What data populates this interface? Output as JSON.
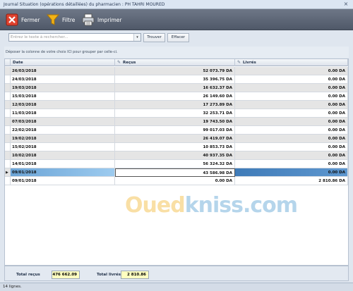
{
  "window": {
    "title": "Journal Situation (opérations détaillées) du pharmacien : PH TAHRI MOURED",
    "close_glyph": "×"
  },
  "toolbar": {
    "buttons": [
      {
        "label": "Fermer",
        "icon": "close-red-icon"
      },
      {
        "label": "Filtre",
        "icon": "funnel-icon"
      },
      {
        "label": "Imprimer",
        "icon": "printer-icon"
      }
    ]
  },
  "search": {
    "placeholder": "Entrez le texte à rechercher...",
    "find_label": "Trouver",
    "clear_label": "Effacer"
  },
  "group_panel": {
    "text": "Déposer la colonne de votre choix ICI pour grouper par celle-ci."
  },
  "grid": {
    "columns": [
      "Date",
      "Reçus",
      "Livrés"
    ],
    "rows": [
      {
        "date": "26/03/2018",
        "recus": "52 073.79 DA",
        "livres": "0.00 DA"
      },
      {
        "date": "24/03/2018",
        "recus": "35 396.75 DA",
        "livres": "0.00 DA"
      },
      {
        "date": "19/03/2018",
        "recus": "16 632.37 DA",
        "livres": "0.00 DA"
      },
      {
        "date": "15/03/2018",
        "recus": "26 149.60 DA",
        "livres": "0.00 DA"
      },
      {
        "date": "12/03/2018",
        "recus": "17 273.89 DA",
        "livres": "0.00 DA"
      },
      {
        "date": "11/03/2018",
        "recus": "32 253.71 DA",
        "livres": "0.00 DA"
      },
      {
        "date": "07/03/2018",
        "recus": "19 743.50 DA",
        "livres": "0.00 DA"
      },
      {
        "date": "22/02/2018",
        "recus": "99 017.03 DA",
        "livres": "0.00 DA"
      },
      {
        "date": "19/02/2018",
        "recus": "26 419.07 DA",
        "livres": "0.00 DA"
      },
      {
        "date": "15/02/2018",
        "recus": "10 853.73 DA",
        "livres": "0.00 DA"
      },
      {
        "date": "10/02/2018",
        "recus": "40 937.35 DA",
        "livres": "0.00 DA"
      },
      {
        "date": "14/01/2018",
        "recus": "56 324.32 DA",
        "livres": "0.00 DA"
      },
      {
        "date": "09/01/2018",
        "recus": "43 586.98 DA",
        "livres": "0.00 DA",
        "selected": true
      },
      {
        "date": "09/01/2018",
        "recus": "0.00 DA",
        "livres": "2 810.86 DA"
      }
    ]
  },
  "watermark": {
    "part1": "Oued",
    "part2": "kniss",
    "part3": ".com"
  },
  "footer": {
    "total_recus_label": "Total reçus",
    "total_recus_value": "476 662.09",
    "total_livres_label": "Total livrés",
    "total_livres_value": "2 810.86"
  },
  "status": {
    "text": "14 lignes."
  },
  "colors": {
    "toolbar": "#5a6373",
    "selection": "#5e97cf",
    "alt_row": "#e5e5e5",
    "total_field": "#ffffc0"
  }
}
